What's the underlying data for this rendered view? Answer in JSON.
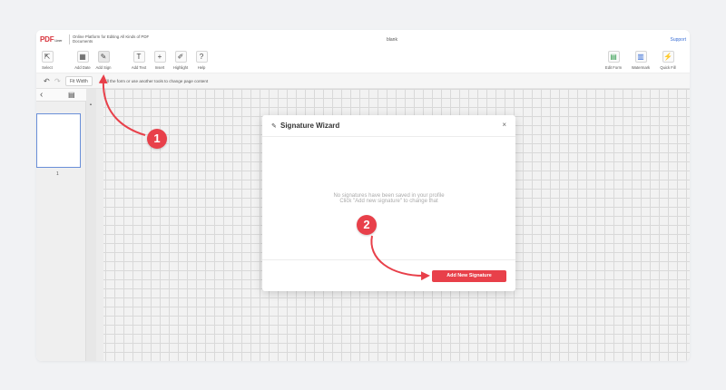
{
  "header": {
    "logo": "PDF",
    "logo_suffix": "Liner",
    "tagline": "Online Platform for Editing All Kinds of PDF Documents",
    "doc_title": "blank",
    "support": "Support"
  },
  "toolbar": {
    "left_tools": [
      {
        "label": "Select",
        "icon": "cursor-icon",
        "glyph": "⇱"
      },
      {
        "label": "Add Date",
        "icon": "calendar-icon",
        "glyph": "▦"
      },
      {
        "label": "Add Sign",
        "icon": "signature-icon",
        "glyph": "✎"
      },
      {
        "label": "Add Text",
        "icon": "text-icon",
        "glyph": "T"
      },
      {
        "label": "Insert",
        "icon": "plus-icon",
        "glyph": "+"
      },
      {
        "label": "Highlight",
        "icon": "highlighter-icon",
        "glyph": "✐"
      },
      {
        "label": "Help",
        "icon": "help-icon",
        "glyph": "?"
      }
    ],
    "right_tools": [
      {
        "label": "Edit Form",
        "icon": "form-icon",
        "glyph": "▤"
      },
      {
        "label": "Watermark",
        "icon": "watermark-icon",
        "glyph": "▥"
      },
      {
        "label": "Quick Fill",
        "icon": "quickfill-icon",
        "glyph": "⚡"
      }
    ]
  },
  "subbar": {
    "fit_width": "Fit Width",
    "hint": "Fill the form or use another tools to change page content"
  },
  "sidebar": {
    "page_number": "1"
  },
  "modal": {
    "title": "Signature Wizard",
    "close": "×",
    "message_line1": "No signatures have been saved in your profile",
    "message_line2": "Click \"Add new signature\" to change that",
    "add_button": "Add New Signature"
  },
  "annotations": {
    "step1": "1",
    "step2": "2",
    "color": "#e8404a"
  }
}
